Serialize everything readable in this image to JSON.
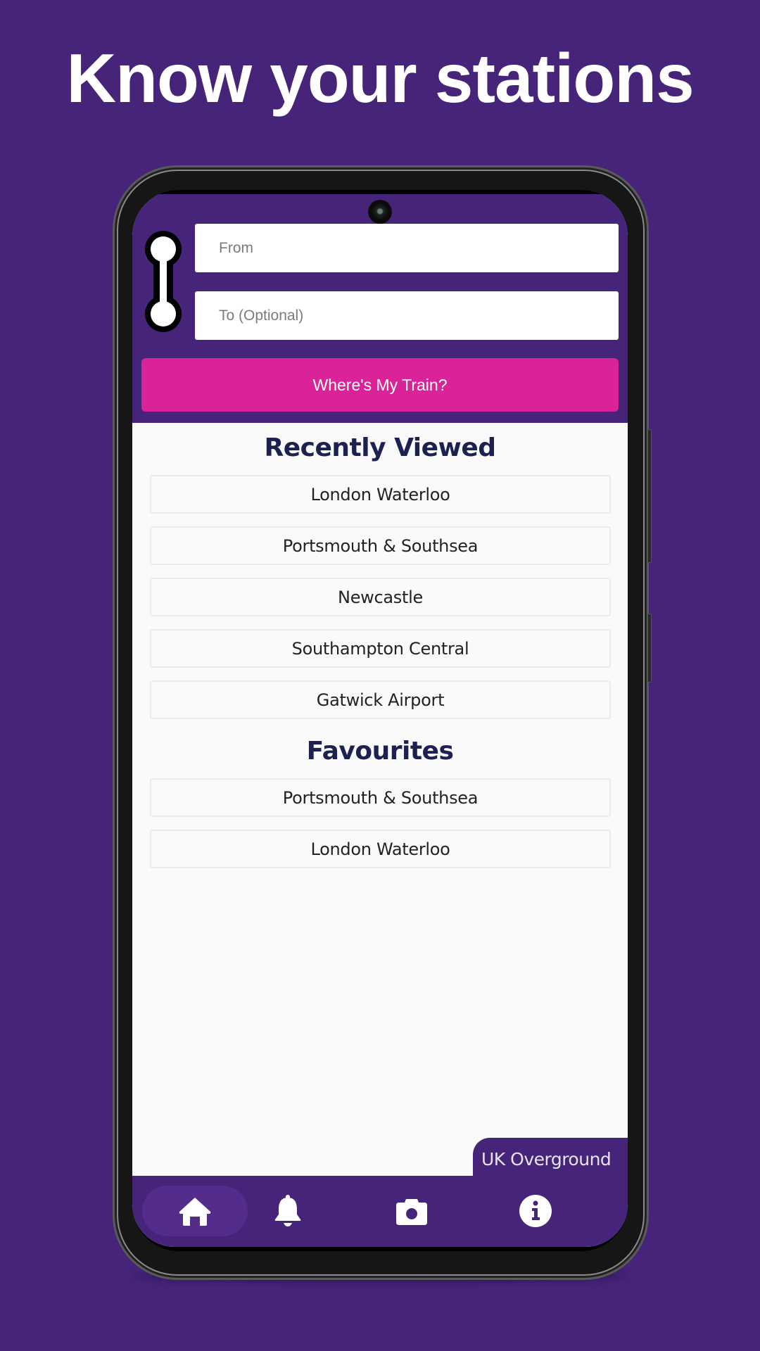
{
  "promo": {
    "headline": "Know your stations"
  },
  "search": {
    "from_placeholder": "From",
    "from_value": "",
    "to_placeholder": "To (Optional)",
    "to_value": "",
    "submit_label": "Where's My Train?"
  },
  "recently_viewed": {
    "title": "Recently Viewed",
    "items": [
      {
        "label": "London Waterloo"
      },
      {
        "label": "Portsmouth & Southsea"
      },
      {
        "label": "Newcastle"
      },
      {
        "label": "Southampton Central"
      },
      {
        "label": "Gatwick Airport"
      }
    ]
  },
  "favourites": {
    "title": "Favourites",
    "items": [
      {
        "label": "Portsmouth & Southsea"
      },
      {
        "label": "London Waterloo"
      }
    ]
  },
  "brand": {
    "label": "UK Overground"
  },
  "nav": {
    "items": [
      {
        "icon": "home-icon",
        "active": true
      },
      {
        "icon": "bell-icon",
        "active": false
      },
      {
        "icon": "camera-icon",
        "active": false
      },
      {
        "icon": "info-icon",
        "active": false
      }
    ]
  },
  "colors": {
    "background": "#46247A",
    "accent": "#DB2399",
    "heading": "#1C2150",
    "list_surface": "#FAFAFA"
  }
}
